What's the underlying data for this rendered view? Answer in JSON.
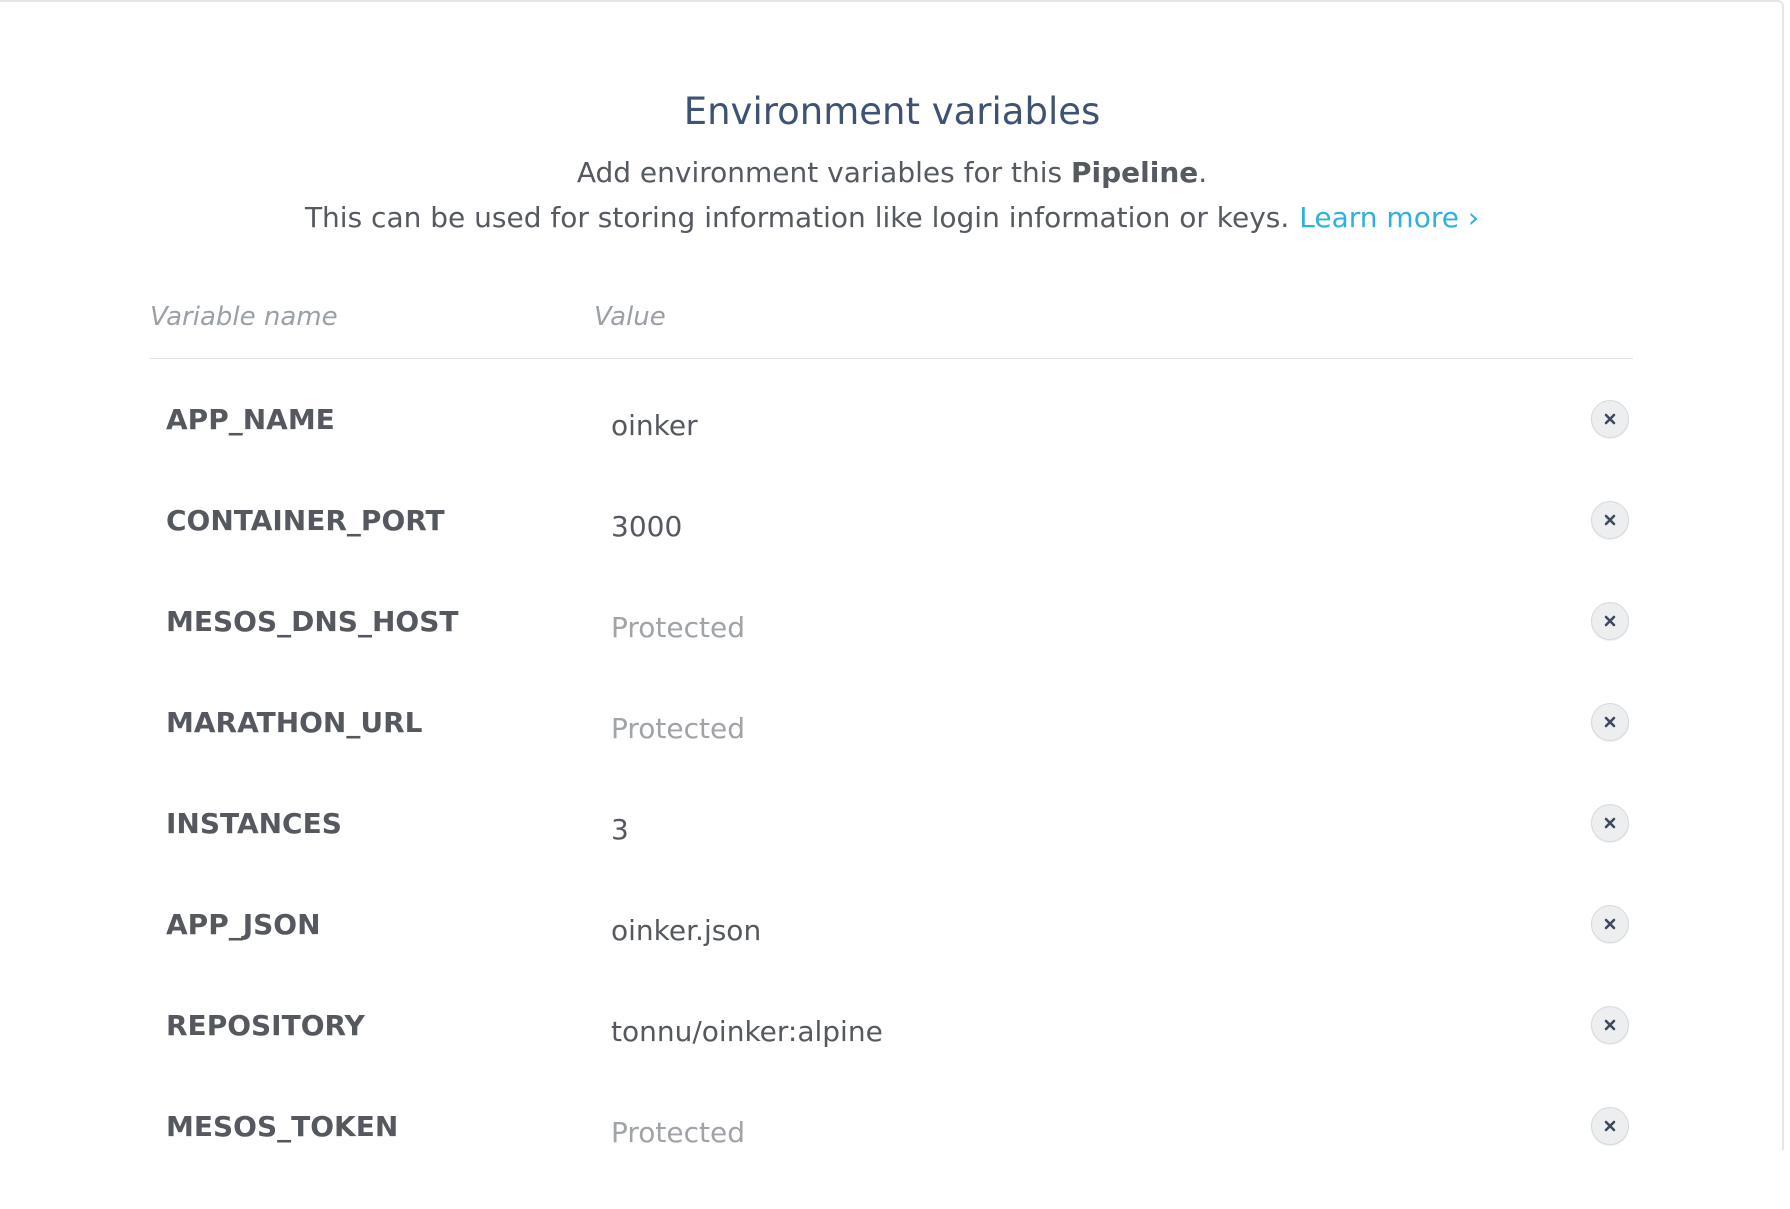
{
  "header": {
    "title": "Environment variables",
    "line1_prefix": "Add environment variables for this ",
    "line1_bold": "Pipeline",
    "line1_suffix": ".",
    "line2_text": "This can be used for storing information like login information or keys.",
    "learn_more_label": "Learn more ›"
  },
  "table": {
    "columns": {
      "name": "Variable name",
      "value": "Value"
    },
    "rows": [
      {
        "name": "APP_NAME",
        "value": "oinker",
        "protected": false
      },
      {
        "name": "CONTAINER_PORT",
        "value": "3000",
        "protected": false
      },
      {
        "name": "MESOS_DNS_HOST",
        "value": "Protected",
        "protected": true
      },
      {
        "name": "MARATHON_URL",
        "value": "Protected",
        "protected": true
      },
      {
        "name": "INSTANCES",
        "value": "3",
        "protected": false
      },
      {
        "name": "APP_JSON",
        "value": "oinker.json",
        "protected": false
      },
      {
        "name": "REPOSITORY",
        "value": "tonnu/oinker:alpine",
        "protected": false
      },
      {
        "name": "MESOS_TOKEN",
        "value": "Protected",
        "protected": true
      }
    ]
  },
  "icons": {
    "remove": "close-icon"
  },
  "colors": {
    "title": "#3e5373",
    "link": "#2fb1e0",
    "text": "#555a61",
    "muted": "#a0a4a9",
    "remove_icon": "#3e4a5c"
  }
}
